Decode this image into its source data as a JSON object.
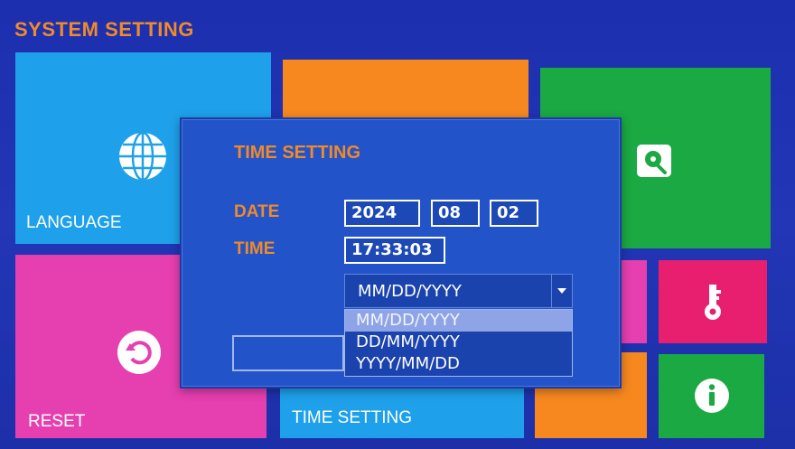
{
  "screen_title": "SYSTEM SETTING",
  "tiles": {
    "language": {
      "label": "LANGUAGE",
      "icon": "globe-icon",
      "color": "#1ea1ea"
    },
    "orange_top": {
      "color": "#f7881f"
    },
    "storage": {
      "icon": "hard-disk-icon",
      "color": "#1aa943"
    },
    "reset": {
      "label": "RESET",
      "icon": "reset-icon",
      "color": "#e63fb0"
    },
    "time_setting": {
      "label": "TIME SETTING",
      "color": "#1ea1ea"
    },
    "pink_mid": {
      "color": "#e63fb0"
    },
    "password": {
      "icon": "key-icon",
      "color": "#e81f6e"
    },
    "orange_bottom": {
      "color": "#f7881f"
    },
    "info": {
      "icon": "info-icon",
      "color": "#1aa943"
    }
  },
  "dialog": {
    "title": "TIME SETTING",
    "date_label": "DATE",
    "date_year": "2024",
    "date_month": "08",
    "date_day": "02",
    "time_label": "TIME",
    "time_value": "17:33:03",
    "date_format_selected": "MM/DD/YYYY",
    "date_format_options": [
      "MM/DD/YYYY",
      "DD/MM/YYYY",
      "YYYY/MM/DD"
    ]
  },
  "colors": {
    "accent": "#f08a2a",
    "dialog_bg": "#2253c8",
    "screen_bg": "#1c2fae"
  }
}
